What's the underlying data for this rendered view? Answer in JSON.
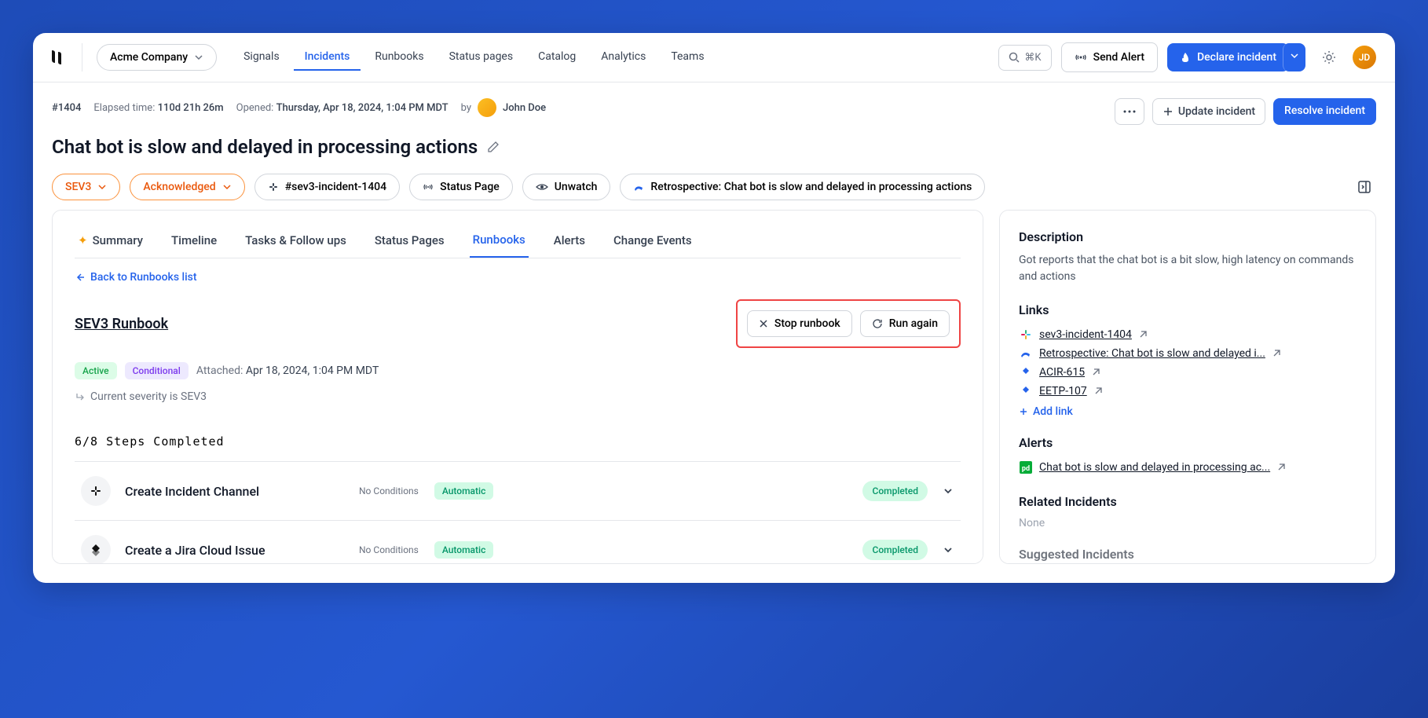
{
  "company": "Acme Company",
  "nav": {
    "tabs": [
      "Signals",
      "Incidents",
      "Runbooks",
      "Status pages",
      "Catalog",
      "Analytics",
      "Teams"
    ],
    "active": 1,
    "search_shortcut": "⌘K",
    "send_alert": "Send Alert",
    "declare": "Declare incident"
  },
  "incident": {
    "id": "#1404",
    "elapsed_label": "Elapsed time:",
    "elapsed": "110d 21h 26m",
    "opened_label": "Opened:",
    "opened": "Thursday, Apr 18, 2024, 1:04 PM MDT",
    "by_label": "by",
    "author": "John Doe",
    "title": "Chat bot is slow and delayed in processing actions",
    "update_btn": "Update incident",
    "resolve_btn": "Resolve incident"
  },
  "pills": {
    "sev": "SEV3",
    "status": "Acknowledged",
    "channel": "#sev3-incident-1404",
    "status_page": "Status Page",
    "unwatch": "Unwatch",
    "retro": "Retrospective: Chat bot is slow and delayed in processing actions"
  },
  "subtabs": [
    "Summary",
    "Timeline",
    "Tasks & Follow ups",
    "Status Pages",
    "Runbooks",
    "Alerts",
    "Change Events"
  ],
  "subtab_active": 4,
  "runbook": {
    "back_label": "Back to Runbooks list",
    "title": "SEV3 Runbook",
    "stop_btn": "Stop runbook",
    "run_again_btn": "Run again",
    "active_tag": "Active",
    "conditional_tag": "Conditional",
    "attached_label": "Attached:",
    "attached_time": "Apr 18, 2024, 1:04 PM MDT",
    "severity_line": "Current severity is SEV3",
    "steps_counter": "6/8 Steps Completed",
    "steps": [
      {
        "title": "Create Incident Channel",
        "cond": "No Conditions",
        "auto": "Automatic",
        "status": "Completed"
      },
      {
        "title": "Create a Jira Cloud Issue",
        "cond": "No Conditions",
        "auto": "Automatic",
        "status": "Completed"
      }
    ]
  },
  "sidebar": {
    "description_title": "Description",
    "description": "Got reports that the chat bot is a bit slow, high latency on commands and actions",
    "links_title": "Links",
    "links": [
      {
        "icon": "slack",
        "text": "sev3-incident-1404"
      },
      {
        "icon": "confluence",
        "text": "Retrospective: Chat bot is slow and delayed i..."
      },
      {
        "icon": "jira",
        "text": "ACIR-615"
      },
      {
        "icon": "jira",
        "text": "EETP-107"
      }
    ],
    "add_link": "Add link",
    "alerts_title": "Alerts",
    "alerts": [
      {
        "icon": "pd",
        "text": "Chat bot is slow and delayed in processing ac..."
      }
    ],
    "related_title": "Related Incidents",
    "related_none": "None",
    "suggested_title": "Suggested Incidents"
  }
}
